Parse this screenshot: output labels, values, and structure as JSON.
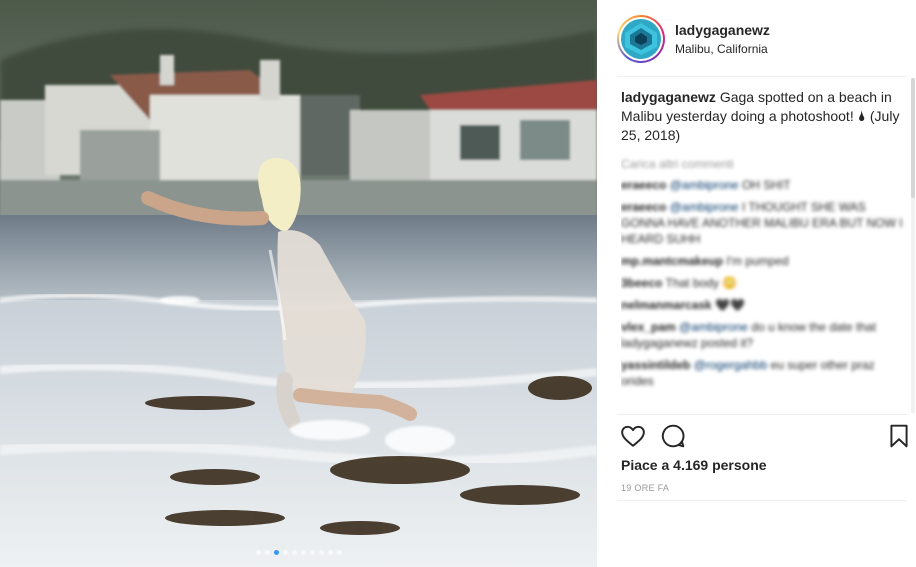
{
  "post": {
    "username": "ladygaganewz",
    "location": "Malibu, California",
    "caption_user": "ladygaganewz",
    "caption_text": "Gaga spotted on a beach in Malibu yesterday doing a photoshoot! 🌢 (July 25, 2018)",
    "load_more": "Carica altri commenti",
    "comments": [
      {
        "user": "eraeeco",
        "mention": "@ambiprone",
        "text": " OH SHIT"
      },
      {
        "user": "eraeeco",
        "mention": "@ambiprone",
        "text": " I THOUGHT SHE WAS GONNA HAVE ANOTHER MALIBU ERA BUT NOW I HEARD SUHH"
      },
      {
        "user": "mp.mantcmakeup",
        "mention": "",
        "text": " I'm pumped"
      },
      {
        "user": "3beeco",
        "mention": "",
        "text": " That body 😳"
      },
      {
        "user": "nelmanmarcask",
        "mention": "",
        "text": " 🖤🖤"
      },
      {
        "user": "vlex_pam",
        "mention": "@ambiprone",
        "text": " do u know the date that ladygaganewz posted it?"
      },
      {
        "user": "yassintildeb",
        "mention": "@rogergahbb",
        "text": " eu super other praz orides"
      }
    ],
    "likes": "Piace a 4.169 persone",
    "time": "19 ORE FA"
  },
  "icons": {
    "like": "heart-icon",
    "comment": "comment-bubble-icon",
    "save": "bookmark-icon"
  },
  "carousel": {
    "count": 10,
    "active": 2
  },
  "colors": {
    "accent": "#3897f0",
    "mention": "#003569",
    "muted": "#999999"
  }
}
